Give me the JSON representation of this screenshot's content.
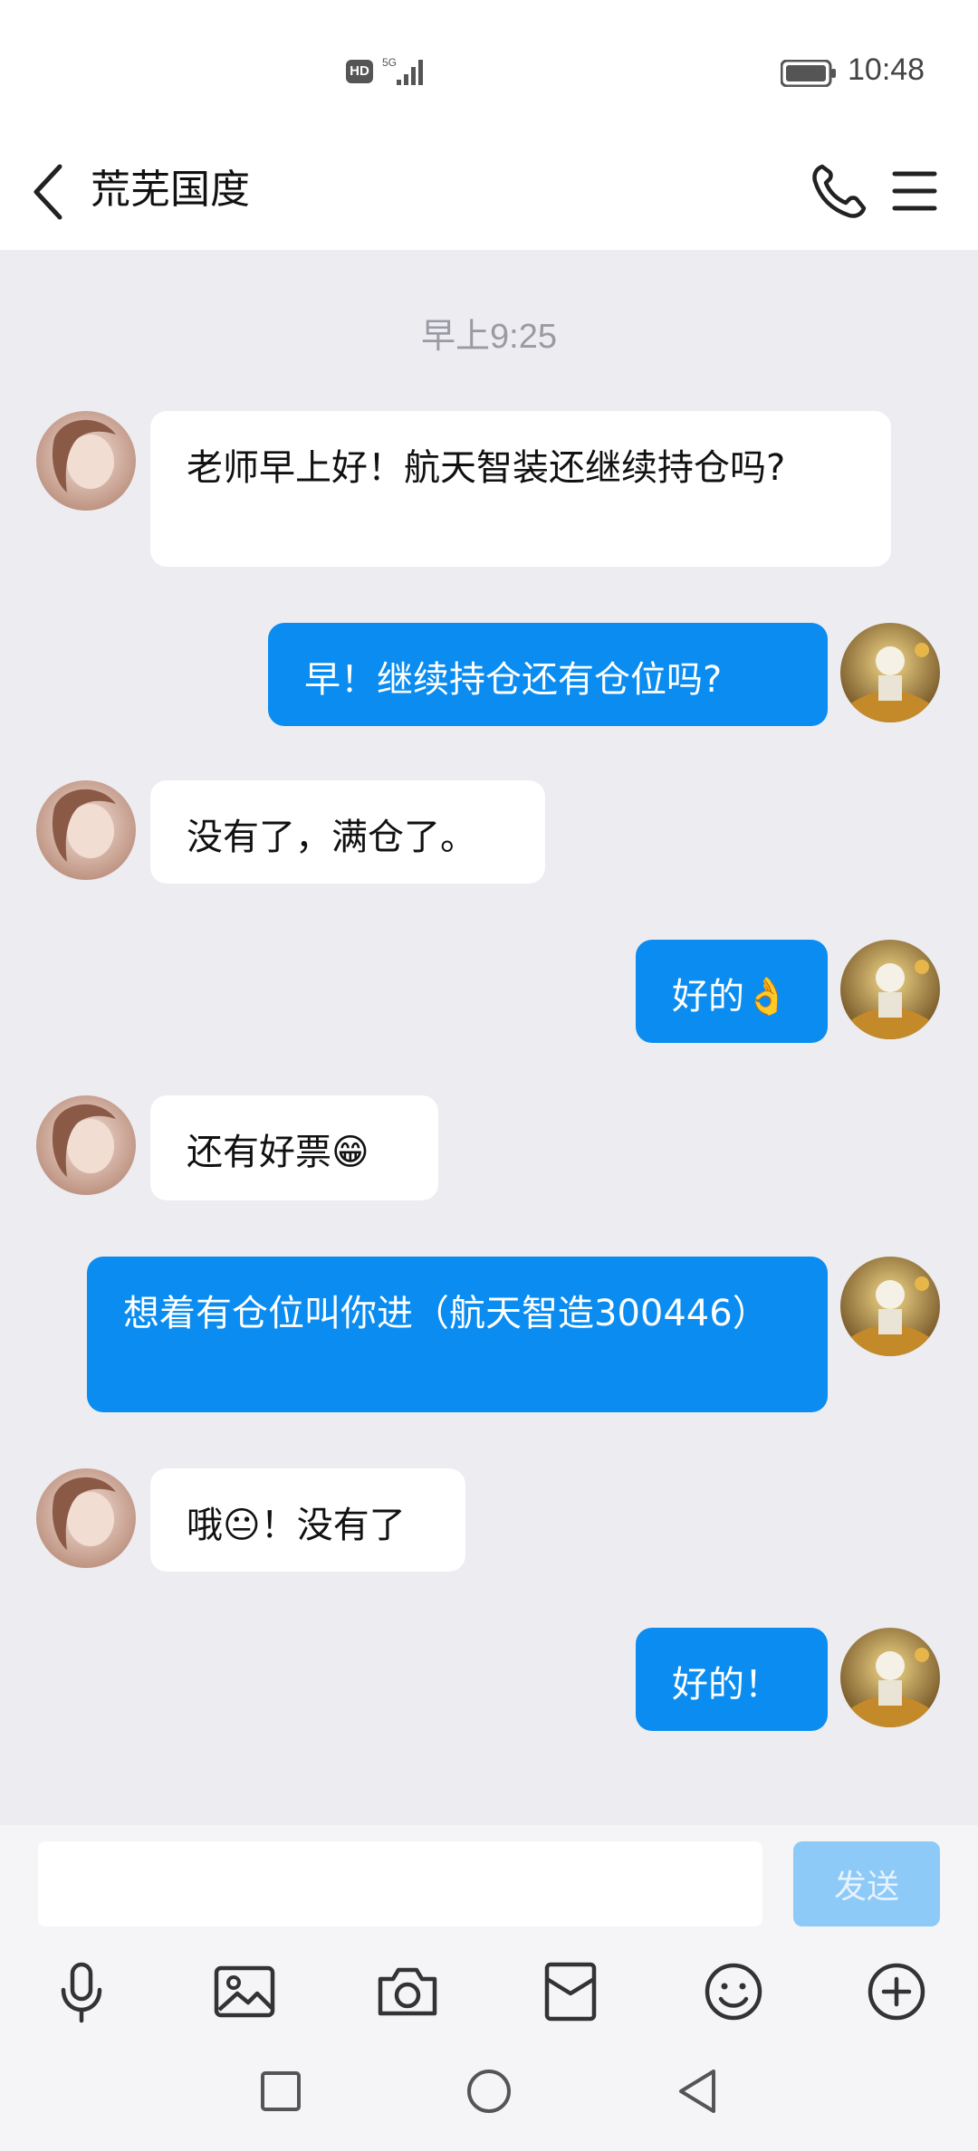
{
  "status_bar": {
    "hd_label": "HD",
    "network_label": "5G",
    "time": "10:48"
  },
  "header": {
    "title": "荒芜国度",
    "icons": [
      "back-arrow-icon",
      "phone-icon",
      "menu-icon"
    ]
  },
  "chat": {
    "timestamp": "早上9:25",
    "messages": [
      {
        "side": "left",
        "text": "老师早上好！航天智装还继续持仓吗?"
      },
      {
        "side": "right",
        "text": "早！继续持仓还有仓位吗?"
      },
      {
        "side": "left",
        "text": "没有了，满仓了。"
      },
      {
        "side": "right",
        "text": "好的👌"
      },
      {
        "side": "left",
        "text": "还有好票😁"
      },
      {
        "side": "right",
        "text": "想着有仓位叫你进（航天智造300446）"
      },
      {
        "side": "left",
        "text": "哦😐！没有了"
      },
      {
        "side": "right",
        "text": "好的！"
      }
    ]
  },
  "input": {
    "placeholder": "",
    "value": "",
    "send_label": "发送"
  },
  "toolbar": {
    "icons": [
      "microphone-icon",
      "image-icon",
      "camera-icon",
      "red-packet-icon",
      "emoji-icon",
      "plus-icon"
    ]
  },
  "system_nav": {
    "icons": [
      "recent-apps-icon",
      "home-icon",
      "back-icon"
    ]
  },
  "colors": {
    "bubble_self": "#0a8cf0",
    "bubble_other": "#ffffff",
    "chat_background": "#ececf1",
    "send_button": "#8ecaf8"
  }
}
